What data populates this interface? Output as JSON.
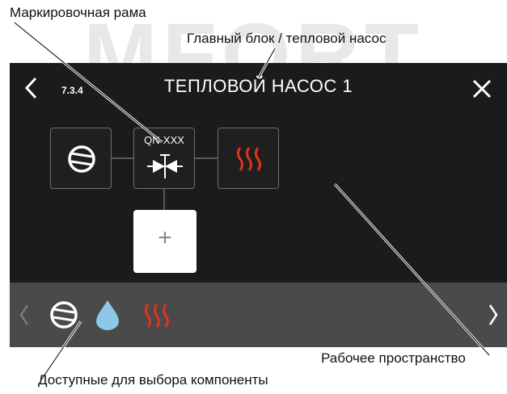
{
  "watermark": "MFORT",
  "callouts": {
    "marking_frame": "Маркировочная рама",
    "main_unit": "Главный блок / тепловой насос",
    "workspace": "Рабочее пространство",
    "components": "Доступные для выбора компоненты"
  },
  "screen": {
    "menu_number": "7.3.4",
    "title": "ТЕПЛОВОЙ НАСОС 1",
    "back_icon": "chevron-left-icon",
    "close_icon": "close-icon"
  },
  "workspace": {
    "nodes": [
      {
        "icon": "compressor-icon",
        "label": ""
      },
      {
        "icon": "valve-icon",
        "label": "QN-XXX"
      },
      {
        "icon": "heating-icon",
        "label": ""
      }
    ],
    "add_label": "+"
  },
  "palette": {
    "items": [
      {
        "icon": "compressor-icon"
      },
      {
        "icon": "water-drop-icon"
      },
      {
        "icon": "heating-icon"
      }
    ],
    "prev_icon": "chevron-left-icon",
    "next_icon": "chevron-right-icon"
  },
  "colors": {
    "screen_bg": "#1b1b1b",
    "palette_bg": "#4a4a4a",
    "heating_red": "#e0321e",
    "water_blue": "#8ec8e8",
    "tile_border": "#6e6e6e"
  }
}
